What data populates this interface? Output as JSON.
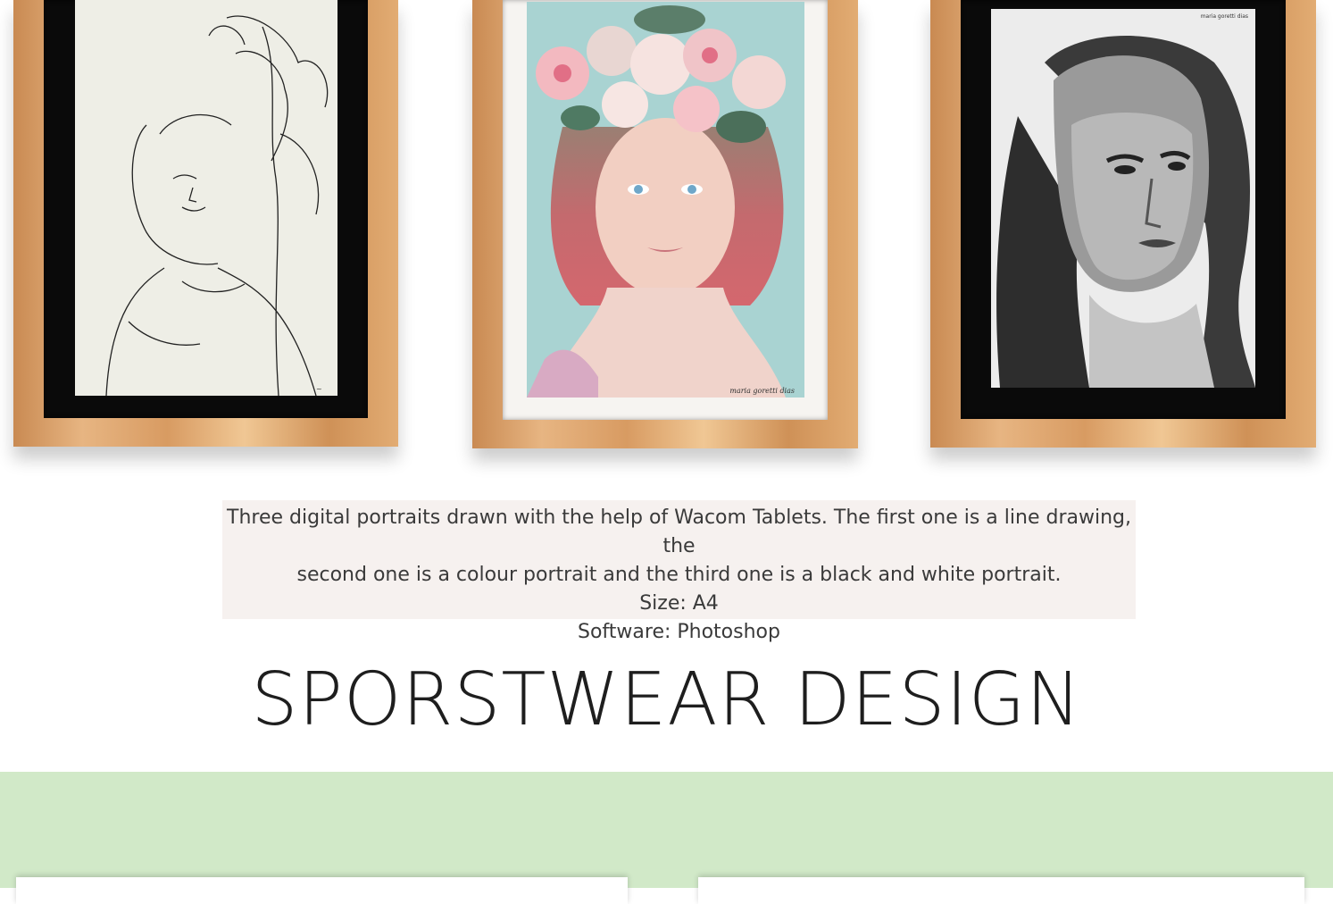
{
  "gallery": {
    "artworks": [
      {
        "icon": "line-drawing-portrait-image",
        "signature": ""
      },
      {
        "icon": "colour-portrait-image",
        "signature": "maria goretti dias"
      },
      {
        "icon": "black-white-portrait-image",
        "signature": "maria goretti dias"
      }
    ]
  },
  "caption": {
    "line1": "Three digital portraits drawn with the help of Wacom Tablets. The first one is a line drawing, the",
    "line2": "second one is a colour portrait and the third one is a black and white portrait.",
    "size": "Size: A4",
    "software": "Software: Photoshop"
  },
  "section": {
    "title": "SPORSTWEAR DESIGN"
  },
  "colors": {
    "caption_bg": "#f6f1ef",
    "band_green": "#d1e9c8",
    "frame_wood": "#e2ac73"
  }
}
